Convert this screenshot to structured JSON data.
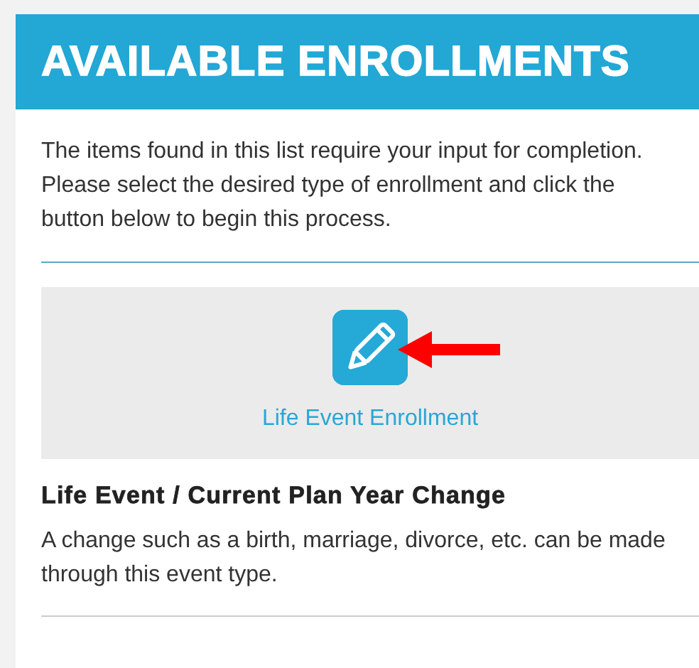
{
  "header": {
    "title": "AVAILABLE ENROLLMENTS"
  },
  "intro": "The items found in this list require your input for completion. Please select the desired type of enrollment and click the button below to begin this process.",
  "options": [
    {
      "button_label": "Life Event Enrollment",
      "highlighted": true,
      "heading": "Life Event / Current Plan Year Change",
      "description": "A change such as a birth, marriage, divorce, etc. can be made through this event type."
    }
  ]
}
